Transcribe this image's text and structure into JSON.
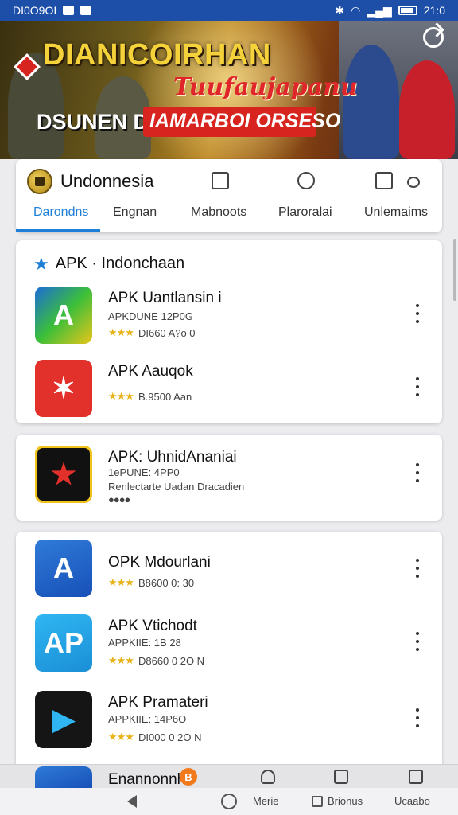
{
  "status_bar": {
    "left_text": "DI0O9OI",
    "time": "21:0"
  },
  "banner": {
    "title_line1": "DIANICOIRHAN",
    "title_line2": "Tuufaujapanu",
    "title_line3": "DSUNEN DAN",
    "title_line4": "IAMARBOI ORSESO"
  },
  "header": {
    "brand": "Undonnesia",
    "tabs": [
      "Darondns",
      "Engnan",
      "Mabnoots",
      "Plaroralai",
      "Unlemaims"
    ]
  },
  "section1": {
    "title": "APK · Indonchaan",
    "apps": [
      {
        "name": "APK Uantlansin i",
        "meta1": "APKDUNE 12P0G",
        "meta2": "DI660 A?o 0",
        "icon": "a-logo-icon"
      },
      {
        "name": "APK Aauqok",
        "meta1": "",
        "meta2": "B.9500 Aan",
        "icon": "star-badge-icon"
      }
    ]
  },
  "section2": {
    "apps": [
      {
        "name": "APK: UhnidAnaniai",
        "meta1": "1ePUNE: 4PP0",
        "meta2": "Renlectarte Uadan Dracadien",
        "icon": "star-flag-icon"
      }
    ]
  },
  "section3": {
    "apps": [
      {
        "name": "OPK Mdourlani",
        "meta1": "",
        "meta2": "B8600 0: 30",
        "icon": "a-logo-blue-icon"
      },
      {
        "name": "APK Vtichodt",
        "meta1": "APPKIIE: 1B 28",
        "meta2": "D8660 0 2O N",
        "icon": "ap-logo-icon"
      },
      {
        "name": "APK Pramateri",
        "meta1": "APPKIIE: 14P6O",
        "meta2": "DI000 0 2O N",
        "icon": "play-logo-icon"
      }
    ]
  },
  "bottom_tabs": {
    "label": "Enannonnh",
    "badge": "B"
  },
  "system_nav": {
    "item1": "Merie",
    "item2": "Brionus",
    "item3": "Ucaabo"
  }
}
